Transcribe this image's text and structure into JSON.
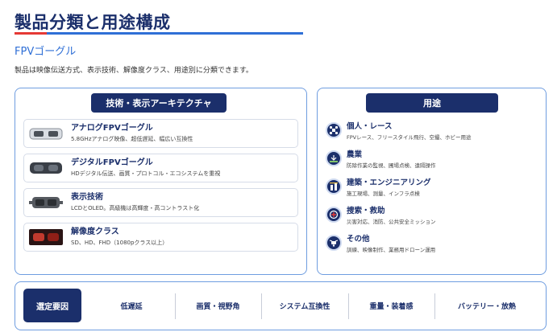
{
  "header": {
    "title": "製品分類と用途構成",
    "subtitle": "FPVゴーグル",
    "description": "製品は映像伝送方式、表示技術、解像度クラス、用途別に分類できます。"
  },
  "tech_panel": {
    "heading": "技術・表示アーキテクチャ",
    "items": [
      {
        "name": "アナログFPVゴーグル",
        "desc": "5.8GHzアナログ映像、超低遅延、幅広い互換性"
      },
      {
        "name": "デジタルFPVゴーグル",
        "desc": "HDデジタル伝送、画質・プロトコル・エコシステムを重視"
      },
      {
        "name": "表示技術",
        "desc": "LCDとOLED。高級機は高輝度・高コントラスト化"
      },
      {
        "name": "解像度クラス",
        "desc": "SD、HD、FHD（1080pクラス以上）"
      }
    ]
  },
  "use_panel": {
    "heading": "用途",
    "items": [
      {
        "name": "個人・レース",
        "desc": "FPVレース、フリースタイル飛行、空撮、ホビー用途"
      },
      {
        "name": "農業",
        "desc": "防除作業の監視、圃場点検、遠隔操作"
      },
      {
        "name": "建築・エンジニアリング",
        "desc": "施工現場、測量、インフラ点検"
      },
      {
        "name": "捜索・救助",
        "desc": "災害対応、消防、公共安全ミッション"
      },
      {
        "name": "その他",
        "desc": "訓練、映像制作、業務用ドローン運用"
      }
    ]
  },
  "factors": {
    "heading": "選定要因",
    "items": [
      "低遅延",
      "画質・視野角",
      "システム互換性",
      "重量・装着感",
      "バッテリー・放熱"
    ]
  },
  "colors": {
    "navy": "#1b2f6b",
    "accent_blue": "#2f6fd6",
    "accent_red": "#e53935",
    "border_blue": "#6f9de0"
  }
}
